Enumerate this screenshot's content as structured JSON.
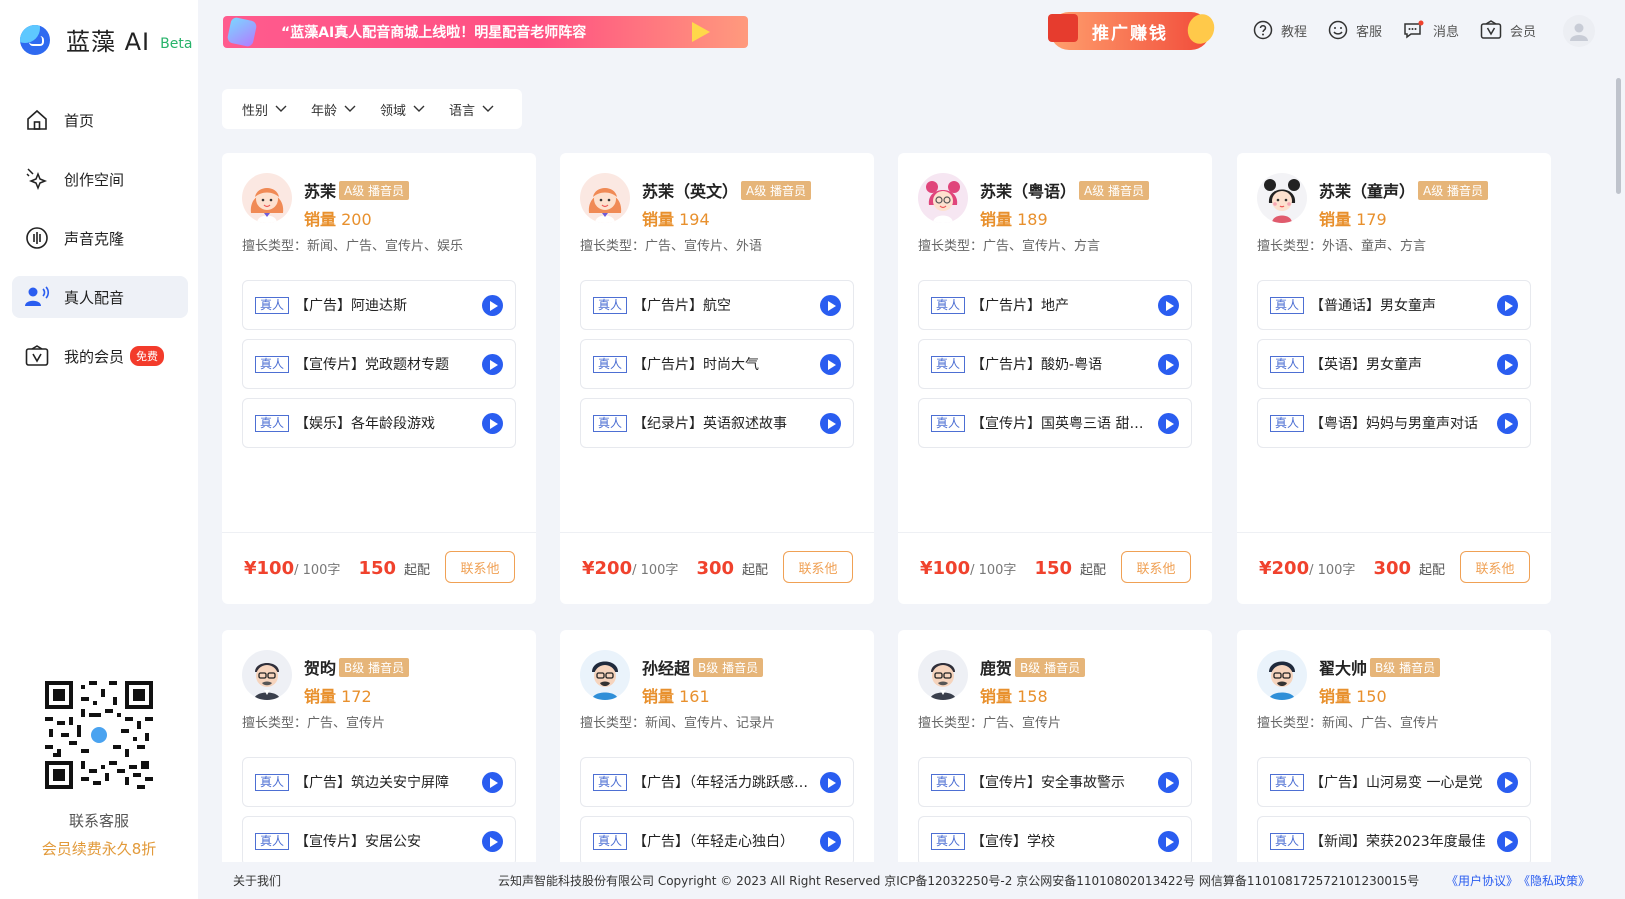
{
  "app": {
    "name": "蓝藻 AI",
    "beta": "Beta"
  },
  "nav": [
    {
      "label": "首页",
      "icon": "home-icon"
    },
    {
      "label": "创作空间",
      "icon": "sparkle-icon"
    },
    {
      "label": "声音克隆",
      "icon": "voice-clone-icon"
    },
    {
      "label": "真人配音",
      "icon": "voice-actor-icon",
      "active": true
    },
    {
      "label": "我的会员",
      "icon": "member-icon",
      "badge": "免费"
    }
  ],
  "sidebar_footer": {
    "contact": "联系客服",
    "promo": "会员续费永久8折"
  },
  "banner": {
    "text": "“蓝藻AI真人配音商城上线啦！明星配音老师阵容"
  },
  "promo_earn": "推广赚钱",
  "toplinks": [
    {
      "label": "教程",
      "icon": "help-icon"
    },
    {
      "label": "客服",
      "icon": "service-icon"
    },
    {
      "label": "消息",
      "icon": "message-icon"
    },
    {
      "label": "会员",
      "icon": "vip-icon"
    }
  ],
  "filters": [
    "性别",
    "年龄",
    "领域",
    "语言"
  ],
  "cards": [
    {
      "name": "苏茉",
      "level": "A级 播音员",
      "sales_label": "销量",
      "sales": "200",
      "specialty": "擅长类型：新闻、广告、宣传片、娱乐",
      "samples": [
        "【广告】阿迪达斯",
        "【宣传片】党政题材专题",
        "【娱乐】各年龄段游戏"
      ],
      "price": "¥100",
      "unit": "/ 100字",
      "min": "150",
      "min_label": "起配",
      "btn": "联系他"
    },
    {
      "name": "苏茉（英文）",
      "level": "A级 播音员",
      "sales_label": "销量",
      "sales": "194",
      "specialty": "擅长类型：广告、宣传片、外语",
      "samples": [
        "【广告片】航空",
        "【广告片】时尚大气",
        "【纪录片】英语叙述故事"
      ],
      "price": "¥200",
      "unit": "/ 100字",
      "min": "300",
      "min_label": "起配",
      "btn": "联系他"
    },
    {
      "name": "苏茉（粤语）",
      "level": "A级 播音员",
      "sales_label": "销量",
      "sales": "189",
      "specialty": "擅长类型：广告、宣传片、方言",
      "samples": [
        "【广告片】地产",
        "【广告片】酸奶-粤语",
        "【宣传片】国英粤三语 甜美女声"
      ],
      "price": "¥100",
      "unit": "/ 100字",
      "min": "150",
      "min_label": "起配",
      "btn": "联系他"
    },
    {
      "name": "苏茉（童声）",
      "level": "A级 播音员",
      "sales_label": "销量",
      "sales": "179",
      "specialty": "擅长类型：外语、童声、方言",
      "samples": [
        "【普通话】男女童声",
        "【英语】男女童声",
        "【粤语】妈妈与男童声对话"
      ],
      "price": "¥200",
      "unit": "/ 100字",
      "min": "300",
      "min_label": "起配",
      "btn": "联系他"
    },
    {
      "name": "贺昀",
      "level": "B级 播音员",
      "sales_label": "销量",
      "sales": "172",
      "specialty": "擅长类型：广告、宣传片",
      "samples": [
        "【广告】筑边关安宁屏障",
        "【宣传片】安居公安"
      ]
    },
    {
      "name": "孙经超",
      "level": "B级 播音员",
      "sales_label": "销量",
      "sales": "161",
      "specialty": "擅长类型：新闻、宣传片、记录片",
      "samples": [
        "【广告】（年轻活力跳跃感觉）",
        "【广告】（年轻走心独白）"
      ]
    },
    {
      "name": "鹿贺",
      "level": "B级 播音员",
      "sales_label": "销量",
      "sales": "158",
      "specialty": "擅长类型：广告、宣传片",
      "samples": [
        "【宣传片】安全事故警示",
        "【宣传】学校"
      ]
    },
    {
      "name": "翟大帅",
      "level": "B级 播音员",
      "sales_label": "销量",
      "sales": "150",
      "specialty": "擅长类型：新闻、广告、宣传片",
      "samples": [
        "【广告】山河易变 一心是党",
        "【新闻】荣获2023年度最佳"
      ]
    }
  ],
  "real_tag": "真人",
  "footer": {
    "about": "关于我们",
    "copyright": "云知声智能科技股份有限公司 Copyright © 2023 All Right Reserved 京ICP备12032250号-2 京公网安备11010802013422号 网信算备110108172572101230015号",
    "terms": "《用户协议》",
    "privacy": "《隐私政策》"
  }
}
